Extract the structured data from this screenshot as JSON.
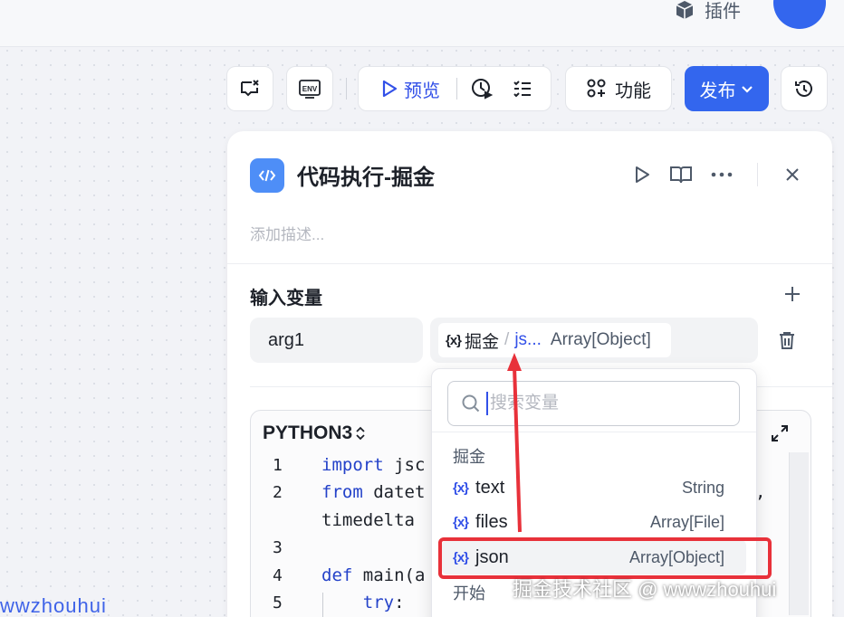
{
  "topbar": {
    "plugin_label": "插件",
    "plugin_icon": "box-icon"
  },
  "toolbar": {
    "preview_label": "预览",
    "features_label": "功能",
    "publish_label": "发布"
  },
  "node": {
    "title": "代码执行-掘金",
    "description_placeholder": "添加描述..."
  },
  "inputs": {
    "section_title": "输入变量",
    "arg_name": "arg1",
    "ref_node": "掘金",
    "ref_separator": "/",
    "ref_var": "js...",
    "ref_type": "Array[Object]",
    "var_badge": "{x}"
  },
  "code": {
    "language": "PYTHON3",
    "lines": [
      {
        "num": "1",
        "text": "import jsc"
      },
      {
        "num": "2",
        "text": "from datet"
      },
      {
        "num": "",
        "text": "timedelta"
      },
      {
        "num": "3",
        "text": ""
      },
      {
        "num": "4",
        "text": "def main(a"
      },
      {
        "num": "5",
        "text": "    try:"
      }
    ],
    "trailing_comma": ","
  },
  "dropdown": {
    "search_placeholder": "搜索变量",
    "group1_label": "掘金",
    "options": [
      {
        "badge": "{x}",
        "name": "text",
        "type": "String"
      },
      {
        "badge": "{x}",
        "name": "files",
        "type": "Array[File]"
      },
      {
        "badge": "{x}",
        "name": "json",
        "type": "Array[Object]"
      }
    ],
    "group2_label": "开始"
  },
  "watermarks": {
    "right": "掘金技术社区 @ wwwzhouhui",
    "left": "wwzhouhui"
  },
  "colors": {
    "accent": "#3366ee",
    "annotation": "#e8313a"
  }
}
